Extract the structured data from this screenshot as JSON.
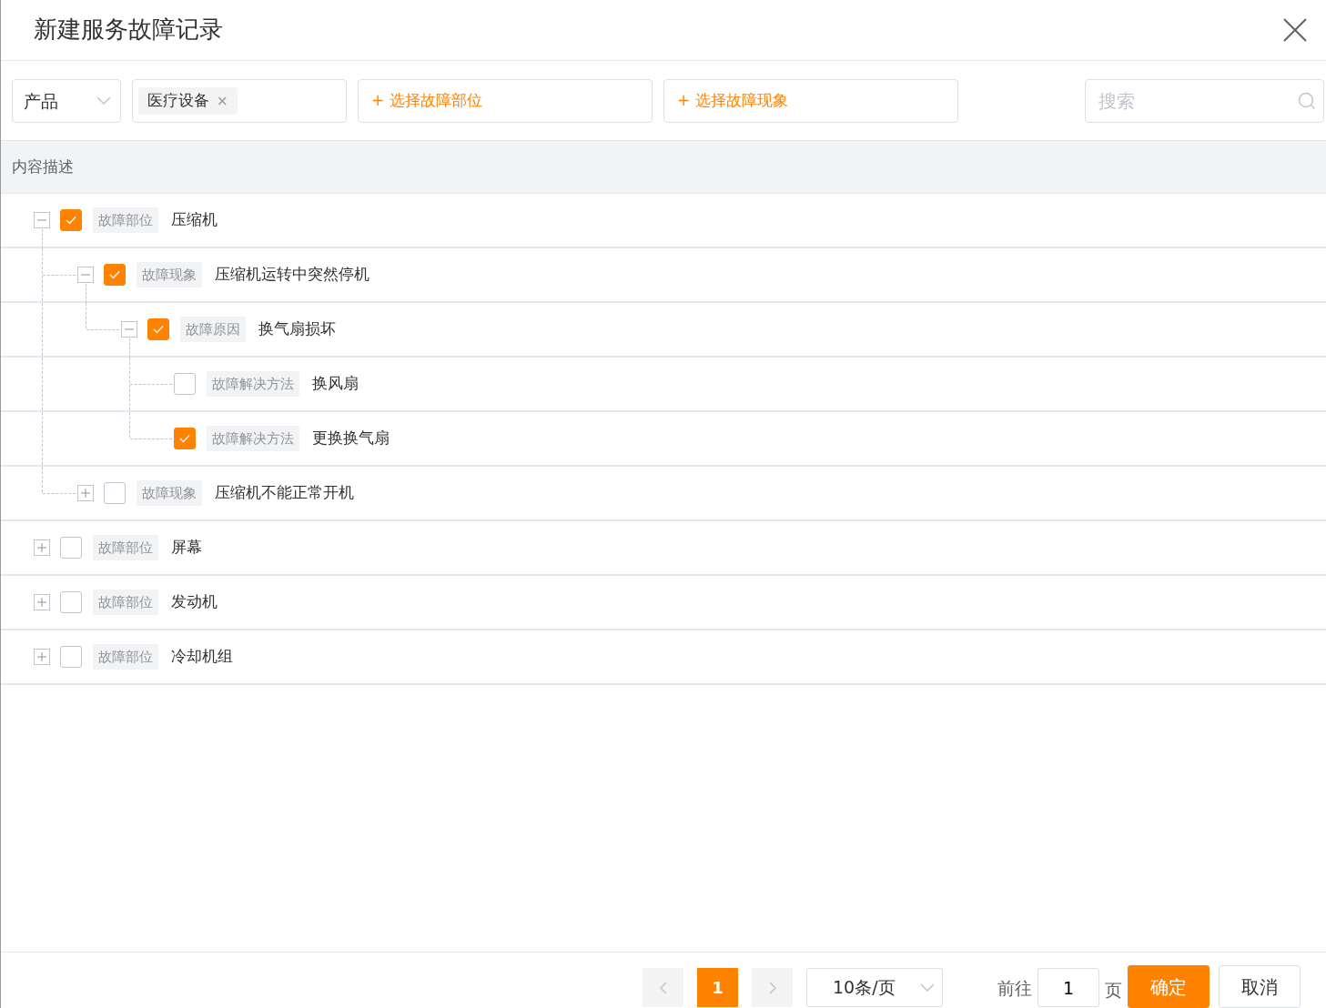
{
  "dialog": {
    "title": "新建服务故障记录"
  },
  "filters": {
    "select": {
      "value": "产品"
    },
    "tags": [
      "医疗设备"
    ],
    "tag_close": "×",
    "buttons": [
      "+ 选择故障部位",
      "+ 选择故障现象"
    ],
    "search": {
      "placeholder": "搜索"
    }
  },
  "table": {
    "columns": [
      "内容描述"
    ],
    "tree": [
      {
        "tag": "故障部位",
        "label": "压缩机",
        "checked": true,
        "expanded": true,
        "children": [
          {
            "tag": "故障现象",
            "label": "压缩机运转中突然停机",
            "checked": true,
            "expanded": true,
            "children": [
              {
                "tag": "故障原因",
                "label": "换气扇损坏",
                "checked": true,
                "expanded": true,
                "children": [
                  {
                    "tag": "故障解决方法",
                    "label": "换风扇",
                    "checked": false
                  },
                  {
                    "tag": "故障解决方法",
                    "label": "更换换气扇",
                    "checked": true
                  }
                ]
              }
            ]
          },
          {
            "tag": "故障现象",
            "label": "压缩机不能正常开机",
            "checked": false,
            "expanded": false
          }
        ]
      },
      {
        "tag": "故障部位",
        "label": "屏幕",
        "checked": false,
        "expanded": false
      },
      {
        "tag": "故障部位",
        "label": "发动机",
        "checked": false,
        "expanded": false
      },
      {
        "tag": "故障部位",
        "label": "冷却机组",
        "checked": false,
        "expanded": false
      }
    ]
  },
  "pagination": {
    "pages": [
      {
        "label": "1",
        "selected": true
      }
    ],
    "page_size": "10条/页",
    "goto_label": "前往",
    "goto_value": "1",
    "page_unit": "页"
  },
  "buttons": [
    {
      "label": "确定",
      "kind": "primary"
    },
    {
      "label": "取消",
      "kind": "default"
    }
  ]
}
